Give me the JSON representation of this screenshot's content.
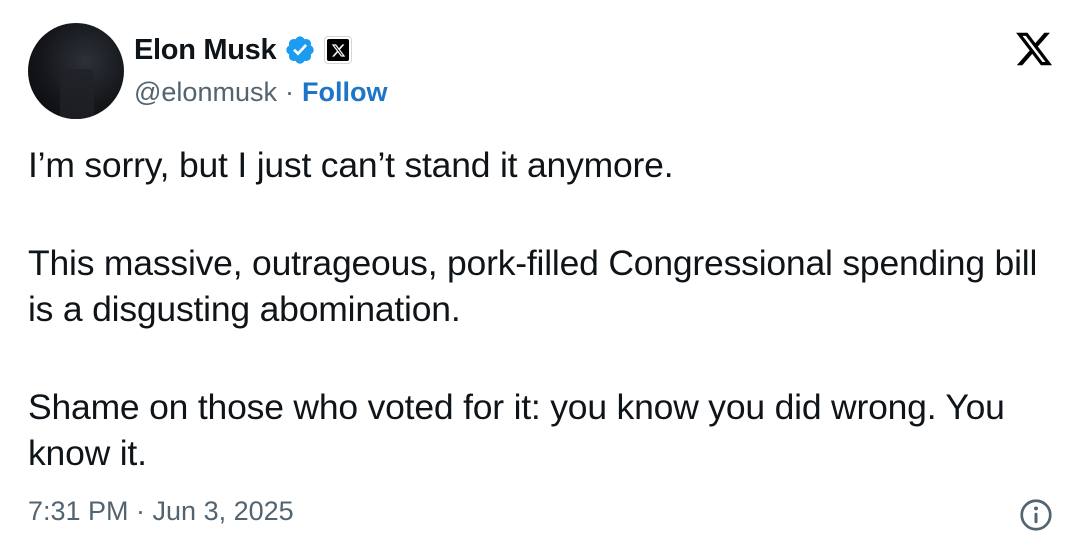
{
  "author": {
    "display_name": "Elon Musk",
    "handle": "@elonmusk",
    "separator": "·",
    "follow_label": "Follow",
    "verified_icon": "verified-badge-icon",
    "affiliate_icon": "x-affiliate-badge-icon"
  },
  "brand": {
    "logo_icon": "x-logo-icon"
  },
  "tweet": {
    "paragraphs": [
      "I’m sorry, but I just can’t stand it anymore.",
      "This massive, outrageous, pork-filled Congressional spending bill is a disgusting abomination.",
      "Shame on those who voted for it: you know you did wrong. You know it."
    ],
    "timestamp": "7:31 PM · Jun 3, 2025"
  },
  "footer": {
    "info_icon": "info-icon"
  },
  "colors": {
    "text_primary": "#0f1419",
    "text_secondary": "#536471",
    "link": "#1d74c8",
    "verified": "#1d9bf0"
  }
}
